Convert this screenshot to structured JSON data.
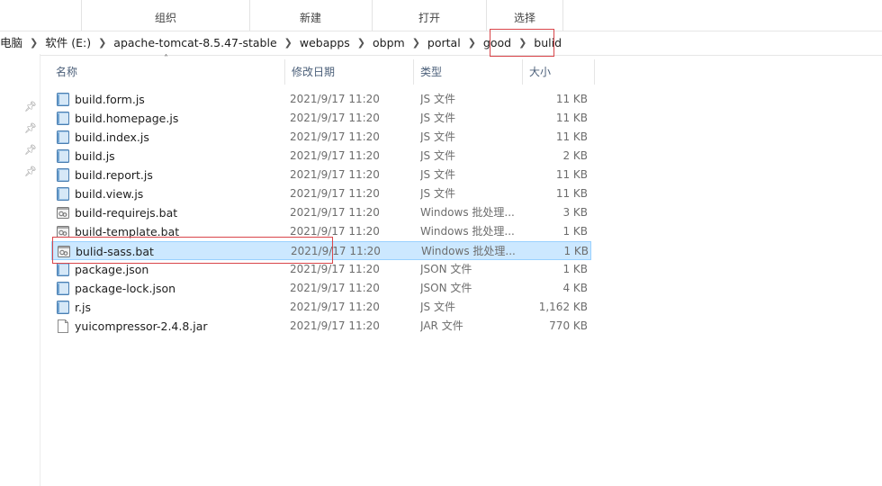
{
  "ribbon": {
    "groups": [
      {
        "label": "组织"
      },
      {
        "label": "新建"
      },
      {
        "label": "打开"
      },
      {
        "label": "选择"
      }
    ]
  },
  "breadcrumb": [
    "电脑",
    "软件 (E:)",
    "apache-tomcat-8.5.47-stable",
    "webapps",
    "obpm",
    "portal",
    "good",
    "bulid"
  ],
  "columns": {
    "name": "名称",
    "date": "修改日期",
    "type": "类型",
    "size": "大小"
  },
  "files": [
    {
      "name": "build.form.js",
      "date": "2021/9/17 11:20",
      "type": "JS 文件",
      "size": "11 KB",
      "icon": "js-file-icon"
    },
    {
      "name": "build.homepage.js",
      "date": "2021/9/17 11:20",
      "type": "JS 文件",
      "size": "11 KB",
      "icon": "js-file-icon"
    },
    {
      "name": "build.index.js",
      "date": "2021/9/17 11:20",
      "type": "JS 文件",
      "size": "11 KB",
      "icon": "js-file-icon"
    },
    {
      "name": "build.js",
      "date": "2021/9/17 11:20",
      "type": "JS 文件",
      "size": "2 KB",
      "icon": "js-file-icon"
    },
    {
      "name": "build.report.js",
      "date": "2021/9/17 11:20",
      "type": "JS 文件",
      "size": "11 KB",
      "icon": "js-file-icon"
    },
    {
      "name": "build.view.js",
      "date": "2021/9/17 11:20",
      "type": "JS 文件",
      "size": "11 KB",
      "icon": "js-file-icon"
    },
    {
      "name": "build-requirejs.bat",
      "date": "2021/9/17 11:20",
      "type": "Windows 批处理...",
      "size": "3 KB",
      "icon": "bat-file-icon"
    },
    {
      "name": "build-template.bat",
      "date": "2021/9/17 11:20",
      "type": "Windows 批处理...",
      "size": "1 KB",
      "icon": "bat-file-icon"
    },
    {
      "name": "bulid-sass.bat",
      "date": "2021/9/17 11:20",
      "type": "Windows 批处理...",
      "size": "1 KB",
      "icon": "bat-file-icon",
      "selected": true
    },
    {
      "name": "package.json",
      "date": "2021/9/17 11:20",
      "type": "JSON 文件",
      "size": "1 KB",
      "icon": "json-file-icon"
    },
    {
      "name": "package-lock.json",
      "date": "2021/9/17 11:20",
      "type": "JSON 文件",
      "size": "4 KB",
      "icon": "json-file-icon"
    },
    {
      "name": "r.js",
      "date": "2021/9/17 11:20",
      "type": "JS 文件",
      "size": "1,162 KB",
      "icon": "js-file-icon"
    },
    {
      "name": "yuicompressor-2.4.8.jar",
      "date": "2021/9/17 11:20",
      "type": "JAR 文件",
      "size": "770 KB",
      "icon": "jar-file-icon"
    }
  ],
  "colors": {
    "selection_bg": "#cce8ff",
    "selection_border": "#99d1ff",
    "highlight_box": "#d9454a",
    "header_text": "#4c607a"
  }
}
